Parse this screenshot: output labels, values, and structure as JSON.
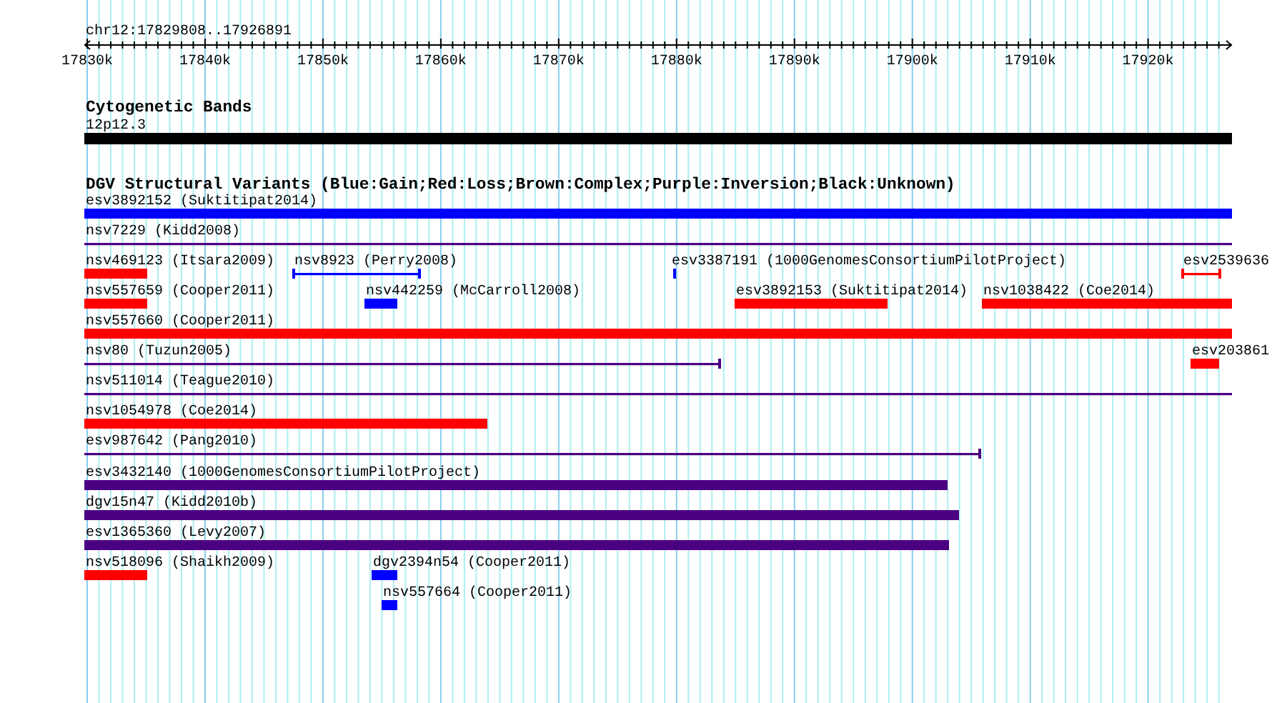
{
  "ruler": {
    "title": "chr12:17829808..17926891",
    "tick_labels": [
      "17830k",
      "17840k",
      "17850k",
      "17860k",
      "17870k",
      "17880k",
      "17890k",
      "17900k",
      "17910k",
      "17920k"
    ]
  },
  "cytogenetic_track": {
    "title": "Cytogenetic Bands",
    "band_label": "12p12.3"
  },
  "variants_track": {
    "title": "DGV Structural Variants (Blue:Gain;Red:Loss;Brown:Complex;Purple:Inversion;Black:Unknown)",
    "features": [
      {
        "label": "esv3892152 (Suktitipat2014)",
        "color": "#0000ff",
        "kind": "bar"
      },
      {
        "label": "nsv7229 (Kidd2008)",
        "color": "#4b0082",
        "kind": "line"
      },
      {
        "label": "nsv469123 (Itsara2009)",
        "color": "#ff0000",
        "kind": "bar"
      },
      {
        "label": "nsv8923 (Perry2008)",
        "color": "#0000ff",
        "kind": "line"
      },
      {
        "label": "esv3387191 (1000GenomesConsortiumPilotProject)",
        "color": "#0000ff",
        "kind": "bar"
      },
      {
        "label": "esv2539636",
        "color": "#ff0000",
        "kind": "line"
      },
      {
        "label": "nsv557659 (Cooper2011)",
        "color": "#ff0000",
        "kind": "bar"
      },
      {
        "label": "nsv442259 (McCarroll2008)",
        "color": "#0000ff",
        "kind": "bar"
      },
      {
        "label": "esv3892153 (Suktitipat2014)",
        "color": "#ff0000",
        "kind": "bar"
      },
      {
        "label": "nsv1038422 (Coe2014)",
        "color": "#ff0000",
        "kind": "bar"
      },
      {
        "label": "nsv557660 (Cooper2011)",
        "color": "#ff0000",
        "kind": "bar"
      },
      {
        "label": "nsv80 (Tuzun2005)",
        "color": "#4b0082",
        "kind": "line"
      },
      {
        "label": "esv203861",
        "color": "#ff0000",
        "kind": "bar"
      },
      {
        "label": "nsv511014 (Teague2010)",
        "color": "#4b0082",
        "kind": "line"
      },
      {
        "label": "nsv1054978 (Coe2014)",
        "color": "#ff0000",
        "kind": "bar"
      },
      {
        "label": "esv987642 (Pang2010)",
        "color": "#4b0082",
        "kind": "line"
      },
      {
        "label": "esv3432140 (1000GenomesConsortiumPilotProject)",
        "color": "#4b0082",
        "kind": "bar"
      },
      {
        "label": "dgv15n47 (Kidd2010b)",
        "color": "#4b0082",
        "kind": "bar"
      },
      {
        "label": "esv1365360 (Levy2007)",
        "color": "#4b0082",
        "kind": "bar"
      },
      {
        "label": "nsv518096 (Shaikh2009)",
        "color": "#ff0000",
        "kind": "bar"
      },
      {
        "label": "dgv2394n54 (Cooper2011)",
        "color": "#0000ff",
        "kind": "bar"
      },
      {
        "label": "nsv557664 (Cooper2011)",
        "color": "#0000ff",
        "kind": "bar"
      }
    ]
  }
}
